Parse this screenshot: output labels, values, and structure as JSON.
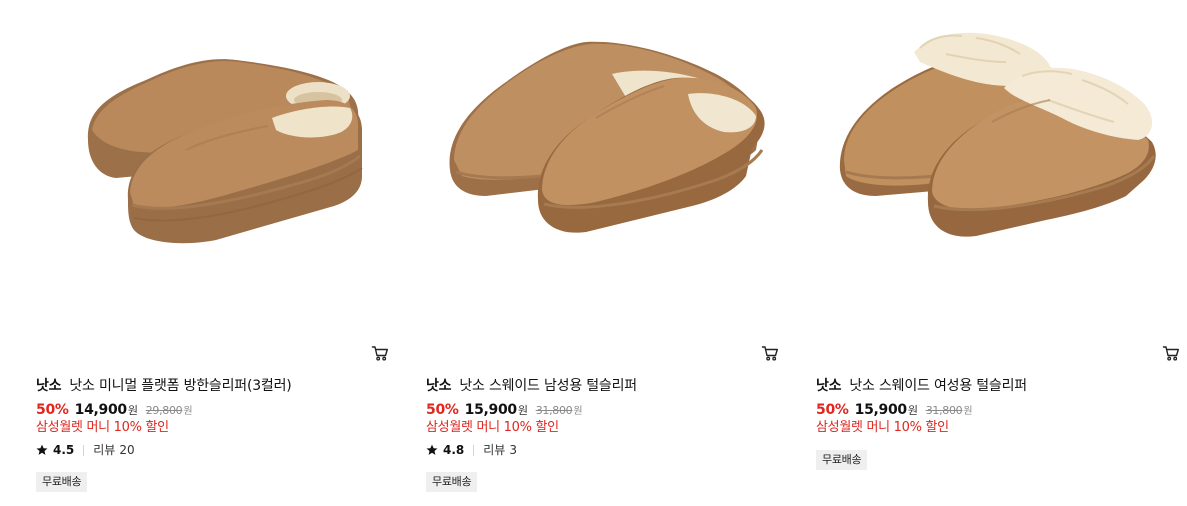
{
  "products": [
    {
      "brand": "낫소",
      "name": "낫소 미니멀 플랫폼 방한슬리퍼(3컬러)",
      "discount": "50%",
      "price": "14,900",
      "price_unit": "원",
      "original_price": "29,800",
      "original_unit": "원",
      "promo": "삼성월렛 머니 10% 할인",
      "rating": "4.5",
      "review_label": "리뷰",
      "review_count": "20",
      "badge": "무료배송",
      "image": "platform-suede-slipper"
    },
    {
      "brand": "낫소",
      "name": "낫소 스웨이드 남성용 털슬리퍼",
      "discount": "50%",
      "price": "15,900",
      "price_unit": "원",
      "original_price": "31,800",
      "original_unit": "원",
      "promo": "삼성월렛 머니 10% 할인",
      "rating": "4.8",
      "review_label": "리뷰",
      "review_count": "3",
      "badge": "무료배송",
      "image": "mens-suede-fur-slipper"
    },
    {
      "brand": "낫소",
      "name": "낫소 스웨이드 여성용 털슬리퍼",
      "discount": "50%",
      "price": "15,900",
      "price_unit": "원",
      "original_price": "31,800",
      "original_unit": "원",
      "promo": "삼성월렛 머니 10% 할인",
      "badge": "무료배송",
      "image": "womens-suede-fur-slipper"
    }
  ],
  "colors": {
    "discount": "#e0261f",
    "promo": "#e0261f",
    "suede": "#b5875a",
    "sole": "#9c7049",
    "fur": "#f0e4cc",
    "badge_bg": "#efefef"
  },
  "icons": {
    "cart": "cart-icon",
    "star": "star-icon"
  }
}
